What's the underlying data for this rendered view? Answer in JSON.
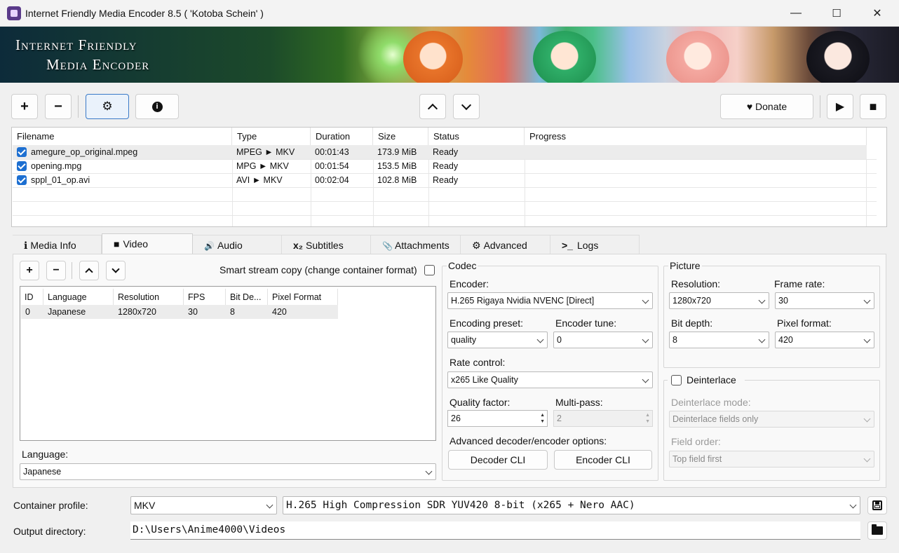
{
  "window": {
    "title": "Internet Friendly Media Encoder 8.5 ( 'Kotoba Schein' )",
    "minimize": "—",
    "maximize": "☐",
    "close": "✕"
  },
  "banner": {
    "line1": "Internet Friendly",
    "line2": "Media Encoder"
  },
  "toolbar": {
    "add": "+",
    "remove": "−",
    "settings": "⚙",
    "info": "i",
    "up": "⌃",
    "down": "⌄",
    "donate": "♥ Donate",
    "play": "▶",
    "stop": "■"
  },
  "files": {
    "columns": [
      "Filename",
      "Type",
      "Duration",
      "Size",
      "Status",
      "Progress"
    ],
    "rows": [
      {
        "checked": true,
        "filename": "amegure_op_original.mpeg",
        "type": "MPEG ► MKV",
        "duration": "00:01:43",
        "size": "173.9 MiB",
        "status": "Ready",
        "progress": ""
      },
      {
        "checked": true,
        "filename": "opening.mpg",
        "type": "MPG ► MKV",
        "duration": "00:01:54",
        "size": "153.5 MiB",
        "status": "Ready",
        "progress": ""
      },
      {
        "checked": true,
        "filename": "sppl_01_op.avi",
        "type": "AVI ► MKV",
        "duration": "00:02:04",
        "size": "102.8 MiB",
        "status": "Ready",
        "progress": ""
      }
    ]
  },
  "tabs": [
    {
      "icon": "info-icon",
      "glyph": "ℹ",
      "label": "Media Info"
    },
    {
      "icon": "video-camera-icon",
      "glyph": "■",
      "label": "Video",
      "selected": true
    },
    {
      "icon": "speaker-icon",
      "glyph": "🔊",
      "label": "Audio"
    },
    {
      "icon": "subtitles-icon",
      "glyph": "x₂",
      "label": "Subtitles"
    },
    {
      "icon": "paperclip-icon",
      "glyph": "📎",
      "label": "Attachments"
    },
    {
      "icon": "gear-icon",
      "glyph": "⚙",
      "label": "Advanced"
    },
    {
      "icon": "terminal-icon",
      "glyph": ">_",
      "label": "Logs"
    }
  ],
  "video": {
    "smart_copy_label": "Smart stream copy (change container format)",
    "smart_copy_checked": false,
    "streams": {
      "columns": [
        "ID",
        "Language",
        "Resolution",
        "FPS",
        "Bit De...",
        "Pixel Format"
      ],
      "rows": [
        {
          "id": "0",
          "language": "Japanese",
          "resolution": "1280x720",
          "fps": "30",
          "bitdepth": "8",
          "pixfmt": "420"
        }
      ]
    },
    "language_label": "Language:",
    "language_value": "Japanese",
    "codec": {
      "group": "Codec",
      "encoder_label": "Encoder:",
      "encoder_value": "H.265 Rigaya Nvidia NVENC [Direct]",
      "preset_label": "Encoding preset:",
      "preset_value": "quality",
      "tune_label": "Encoder tune:",
      "tune_value": "0",
      "rate_label": "Rate control:",
      "rate_value": "x265 Like Quality",
      "quality_label": "Quality factor:",
      "quality_value": "26",
      "multipass_label": "Multi-pass:",
      "multipass_value": "2",
      "advanced_label": "Advanced decoder/encoder options:",
      "decoder_cli": "Decoder CLI",
      "encoder_cli": "Encoder CLI"
    },
    "picture": {
      "group": "Picture",
      "resolution_label": "Resolution:",
      "resolution_value": "1280x720",
      "framerate_label": "Frame rate:",
      "framerate_value": "30",
      "bitdepth_label": "Bit depth:",
      "bitdepth_value": "8",
      "pixfmt_label": "Pixel format:",
      "pixfmt_value": "420"
    },
    "deinterlace": {
      "label": "Deinterlace",
      "checked": false,
      "mode_label": "Deinterlace mode:",
      "mode_value": "Deinterlace fields only",
      "order_label": "Field order:",
      "order_value": "Top field first"
    }
  },
  "bottom": {
    "container_label": "Container profile:",
    "container_value": "MKV",
    "profile_value": "H.265 High Compression SDR YUV420 8-bit (x265 + Nero AAC)",
    "output_label": "Output directory:",
    "output_value": "D:\\Users\\Anime4000\\Videos"
  }
}
